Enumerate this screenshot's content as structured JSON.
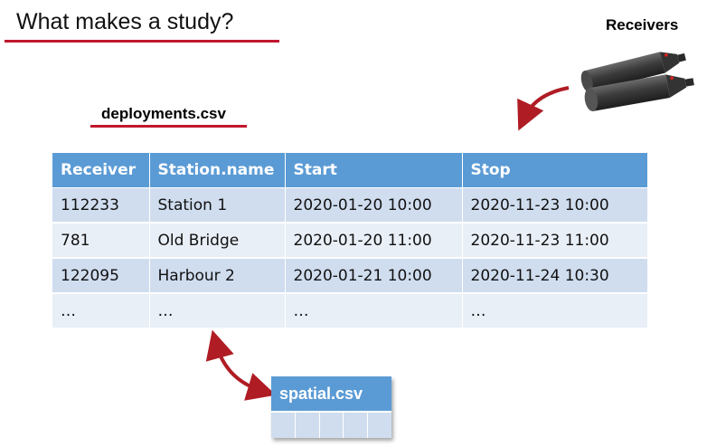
{
  "slide": {
    "title": "What makes a study?",
    "accent_color": "#c0172d",
    "table_header_color": "#5b9bd5"
  },
  "receivers": {
    "label": "Receivers",
    "icon": "receiver-devices-image"
  },
  "deployments": {
    "file_label": "deployments.csv",
    "columns": [
      "Receiver",
      "Station.name",
      "Start",
      "Stop"
    ],
    "rows": [
      [
        "112233",
        "Station 1",
        "2020-01-20 10:00",
        "2020-11-23 10:00"
      ],
      [
        "781",
        "Old Bridge",
        "2020-01-20 11:00",
        "2020-11-23 11:00"
      ],
      [
        "122095",
        "Harbour  2",
        "2020-01-21 10:00",
        "2020-11-24 10:30"
      ],
      [
        "…",
        "…",
        "…",
        "…"
      ]
    ]
  },
  "spatial": {
    "file_label": "spatial.csv"
  }
}
